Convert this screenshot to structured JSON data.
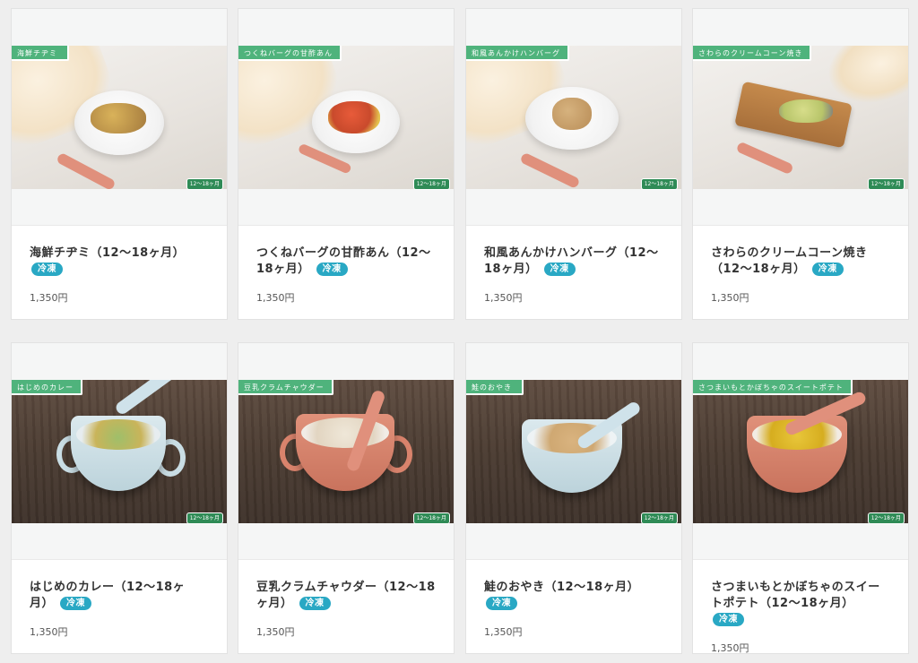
{
  "products": [
    {
      "image_label": "海鮮チヂミ",
      "age_badge": "12〜18ヶ月",
      "title": "海鮮チヂミ（12〜18ヶ月）",
      "badge": "冷凍",
      "price": "1,350円"
    },
    {
      "image_label": "つくねバーグの甘酢あん",
      "age_badge": "12〜18ヶ月",
      "title": "つくねバーグの甘酢あん（12〜18ヶ月）",
      "badge": "冷凍",
      "price": "1,350円"
    },
    {
      "image_label": "和風あんかけハンバーグ",
      "age_badge": "12〜18ヶ月",
      "title": "和風あんかけハンバーグ（12〜18ヶ月）",
      "badge": "冷凍",
      "price": "1,350円"
    },
    {
      "image_label": "さわらのクリームコーン焼き",
      "age_badge": "12〜18ヶ月",
      "title": "さわらのクリームコーン焼き（12〜18ヶ月）",
      "badge": "冷凍",
      "price": "1,350円"
    },
    {
      "image_label": "はじめのカレー",
      "age_badge": "12〜18ヶ月",
      "title": "はじめのカレー（12〜18ヶ月）",
      "badge": "冷凍",
      "price": "1,350円"
    },
    {
      "image_label": "豆乳クラムチャウダー",
      "age_badge": "12〜18ヶ月",
      "title": "豆乳クラムチャウダー（12〜18ヶ月）",
      "badge": "冷凍",
      "price": "1,350円"
    },
    {
      "image_label": "鮭のおやき",
      "age_badge": "12〜18ヶ月",
      "title": "鮭のおやき（12〜18ヶ月）",
      "badge": "冷凍",
      "price": "1,350円"
    },
    {
      "image_label": "さつまいもとかぼちゃのスイートポテト",
      "age_badge": "12〜18ヶ月",
      "title": "さつまいもとかぼちゃのスイートポテト（12〜18ヶ月）",
      "badge": "冷凍",
      "price": "1,350円"
    }
  ],
  "colors": {
    "background": "#eeeeee",
    "frozen_badge": "#29a8c4",
    "image_tag": "#4fb37c"
  }
}
